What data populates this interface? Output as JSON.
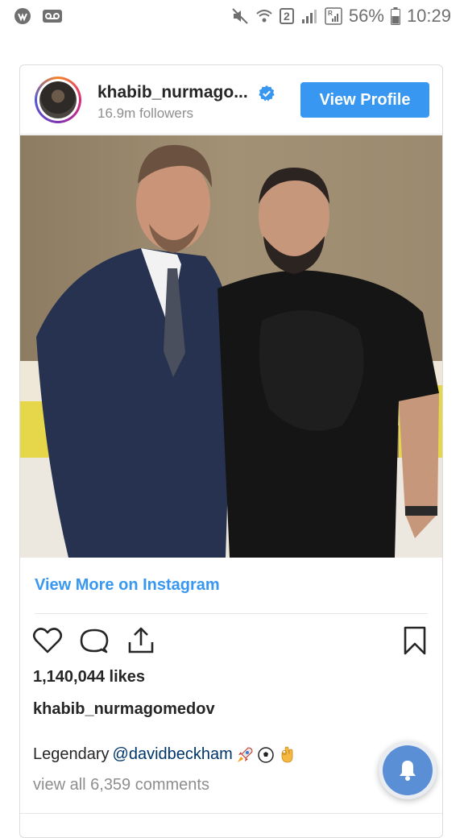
{
  "status_bar": {
    "battery": "56%",
    "time": "10:29",
    "sim_label": "2",
    "icons": [
      "app-icon",
      "voicemail-icon",
      "mute-icon",
      "wifi-icon",
      "sim-icon",
      "signal-icon",
      "signal-roaming-icon",
      "battery-icon"
    ]
  },
  "post": {
    "username": "khabib_nurmago...",
    "followers": "16.9m followers",
    "view_profile": "View Profile",
    "view_more": "View More on Instagram",
    "likes": "1,140,044 likes",
    "author": "khabib_nurmagomedov",
    "caption_prefix": "Legendary",
    "mention": "@davidbeckham",
    "comments": "view all 6,359 comments",
    "accent_color": "#3897f0"
  }
}
